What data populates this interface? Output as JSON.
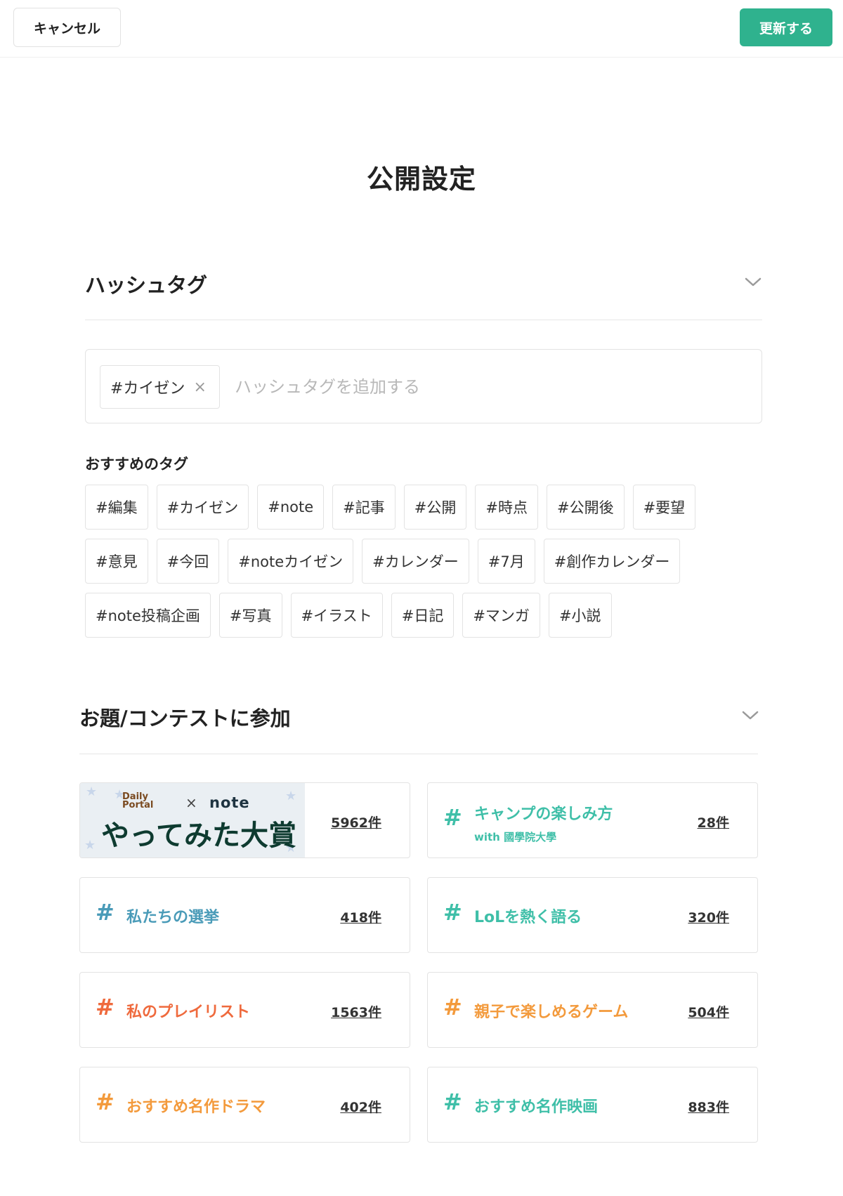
{
  "header": {
    "cancel_label": "キャンセル",
    "update_label": "更新する",
    "accent_color": "#2fb28e"
  },
  "page_title": "公開設定",
  "hashtag_section": {
    "title": "ハッシュタグ",
    "toggle_icon": "chevron-down-icon",
    "current_tags": [
      "#カイゼン"
    ],
    "remove_icon": "×",
    "input_placeholder": "ハッシュタグを追加する",
    "input_value": "",
    "suggest_label": "おすすめのタグ",
    "suggested_tags": [
      "#編集",
      "#カイゼン",
      "#note",
      "#記事",
      "#公開",
      "#時点",
      "#公開後",
      "#要望",
      "#意見",
      "#今回",
      "#noteカイゼン",
      "#カレンダー",
      "#7月",
      "#創作カレンダー",
      "#note投稿企画",
      "#写真",
      "#イラスト",
      "#日記",
      "#マンガ",
      "#小説"
    ]
  },
  "contest_section": {
    "title": "お題/コンテストに参加",
    "toggle_icon": "chevron-down-icon",
    "banner_card": {
      "brand_line1": "Daily",
      "brand_line2": "Portal",
      "cross": "×",
      "note_brand": "note",
      "headline": "やってみた大賞",
      "count": "5962件"
    },
    "cards": [
      {
        "hash": "#",
        "name": "キャンプの楽しみ方",
        "sub": "with 國學院大學",
        "count": "28件",
        "color": "#3fbfa8"
      },
      {
        "hash": "#",
        "name": "私たちの選挙",
        "sub": "",
        "count": "418件",
        "color": "#4a9bb8"
      },
      {
        "hash": "#",
        "name": "LoLを熱く語る",
        "sub": "",
        "count": "320件",
        "color": "#3fbfa8"
      },
      {
        "hash": "#",
        "name": "私のプレイリスト",
        "sub": "",
        "count": "1563件",
        "color": "#ef6a3d"
      },
      {
        "hash": "#",
        "name": "親子で楽しめるゲーム",
        "sub": "",
        "count": "504件",
        "color": "#f39a3c"
      },
      {
        "hash": "#",
        "name": "おすすめ名作ドラマ",
        "sub": "",
        "count": "402件",
        "color": "#f39a3c"
      },
      {
        "hash": "#",
        "name": "おすすめ名作映画",
        "sub": "",
        "count": "883件",
        "color": "#3fbfa8"
      }
    ]
  }
}
